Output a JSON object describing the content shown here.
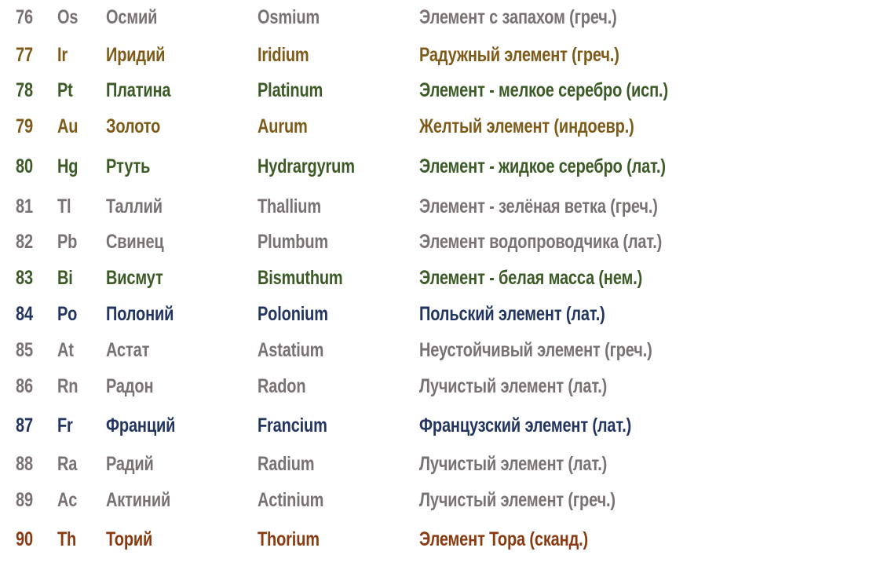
{
  "colors": {
    "grey": "#7a7272",
    "brown": "#7d5a18",
    "green": "#3b5a26",
    "navy": "#223561",
    "rust": "#8a3a10"
  },
  "rows": [
    {
      "num": "76",
      "sym": "Os",
      "ru": "Осмий",
      "lat": "Osmium",
      "meaning": "Элемент с запахом (греч.)",
      "color": "grey"
    },
    {
      "num": "77",
      "sym": "Ir",
      "ru": "Иридий",
      "lat": "Iridium",
      "meaning": "Радужный элемент (греч.)",
      "color": "brown"
    },
    {
      "num": "78",
      "sym": "Pt",
      "ru": "Платина",
      "lat": "Platinum",
      "meaning": "Элемент - мелкое серебро (исп.)",
      "color": "green"
    },
    {
      "num": "79",
      "sym": "Au",
      "ru": "Золото",
      "lat": "Aurum",
      "meaning": "Желтый элемент (индоевр.)",
      "color": "brown"
    },
    {
      "num": "80",
      "sym": "Hg",
      "ru": "Ртуть",
      "lat": "Hydrargyrum",
      "meaning": "Элемент - жидкое серебро (лат.)",
      "color": "green"
    },
    {
      "num": "81",
      "sym": "Tl",
      "ru": "Таллий",
      "lat": "Thallium",
      "meaning": "Элемент - зелёная ветка (греч.)",
      "color": "grey"
    },
    {
      "num": "82",
      "sym": "Pb",
      "ru": "Свинец",
      "lat": "Plumbum",
      "meaning": "Элемент водопроводчика (лат.)",
      "color": "grey"
    },
    {
      "num": "83",
      "sym": "Bi",
      "ru": "Висмут",
      "lat": "Bismuthum",
      "meaning": "Элемент - белая масса (нем.)",
      "color": "green"
    },
    {
      "num": "84",
      "sym": "Po",
      "ru": "Полоний",
      "lat": "Polonium",
      "meaning": "Польский элемент (лат.)",
      "color": "navy"
    },
    {
      "num": "85",
      "sym": "At",
      "ru": "Астат",
      "lat": "Astatium",
      "meaning": "Неустойчивый элемент (греч.)",
      "color": "grey"
    },
    {
      "num": "86",
      "sym": "Rn",
      "ru": "Радон",
      "lat": "Radon",
      "meaning": "Лучистый элемент (лат.)",
      "color": "grey"
    },
    {
      "num": "87",
      "sym": "Fr",
      "ru": "Франций",
      "lat": "Francium",
      "meaning": "Французский элемент (лат.)",
      "color": "navy"
    },
    {
      "num": "88",
      "sym": "Ra",
      "ru": "Радий",
      "lat": "Radium",
      "meaning": "Лучистый элемент (лат.)",
      "color": "grey"
    },
    {
      "num": "89",
      "sym": "Ac",
      "ru": "Актиний",
      "lat": "Actinium",
      "meaning": "Лучистый элемент (греч.)",
      "color": "grey"
    },
    {
      "num": "90",
      "sym": "Th",
      "ru": "Торий",
      "lat": "Thorium",
      "meaning": "Элемент Тора (сканд.)",
      "color": "rust"
    }
  ]
}
